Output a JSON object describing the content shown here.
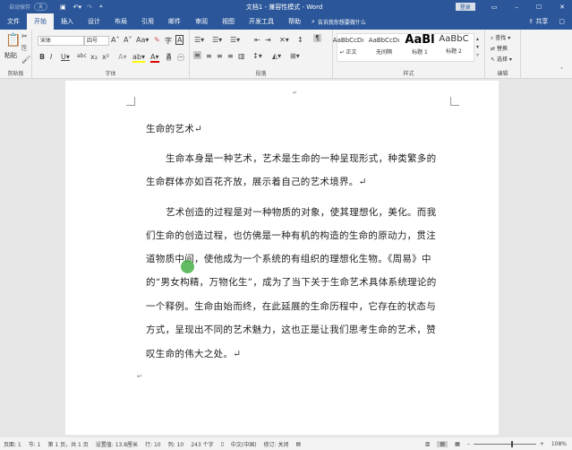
{
  "titlebar": {
    "autosave": "自动保存",
    "autosave_state": "关",
    "title": "文档1 - 兼容性模式 - Word",
    "login": "登录"
  },
  "tabs": [
    "文件",
    "开始",
    "插入",
    "设计",
    "布局",
    "引用",
    "邮件",
    "审阅",
    "视图",
    "开发工具",
    "帮助"
  ],
  "search_placeholder": "告诉我你想要做什么",
  "share": "共享",
  "ribbon": {
    "clipboard": {
      "paste": "粘贴",
      "label": "剪贴板"
    },
    "font": {
      "name": "宋体",
      "size": "四号",
      "label": "字体"
    },
    "paragraph": {
      "label": "段落"
    },
    "styles": {
      "label": "样式",
      "items": [
        {
          "preview": "AaBbCcDı",
          "name": "↵ 正文"
        },
        {
          "preview": "AaBbCcDı",
          "name": "无间隔"
        },
        {
          "preview": "AaBl",
          "name": "标题 1"
        },
        {
          "preview": "AaBbC",
          "name": "标题 2"
        }
      ]
    },
    "editing": {
      "find": "查找",
      "replace": "替换",
      "select": "选择",
      "label": "编辑"
    }
  },
  "document": {
    "lines": [
      "生命的艺术↵",
      "生命本身是一种艺术，艺术是生命的一种呈现形式，种类繁多的",
      "生命群体亦如百花齐放，展示着自己的艺术境界。↵",
      "艺术创造的过程是对一种物质的对象，使其理想化，美化。而我",
      "们生命的创造过程，也仿佛是一种有机的构造的生命的原动力，贯注",
      "道物质中间，使他成为一个系统的有组织的理想化生物。《周易》中",
      "的“男女构精，万物化生”，成为了当下关于生命艺术具体系统理论的",
      "一个释例。生命由始而终，在此延展的生命历程中，它存在的状态与",
      "方式，呈现出不同的艺术魅力，这也正是让我们思考生命的艺术，赞",
      "叹生命的伟大之处。↵"
    ],
    "end_mark": "↵"
  },
  "status": {
    "page": "页面: 1",
    "section": "节: 1",
    "pages": "第 1 页，共 1 页",
    "position": "设置值: 13.8厘米",
    "row": "行: 10",
    "col": "列: 10",
    "words": "243 个字",
    "lang": "中文(中国)",
    "track": "修订: 关闭",
    "zoom": "108%"
  },
  "colors": {
    "brand": "#2b579a"
  }
}
